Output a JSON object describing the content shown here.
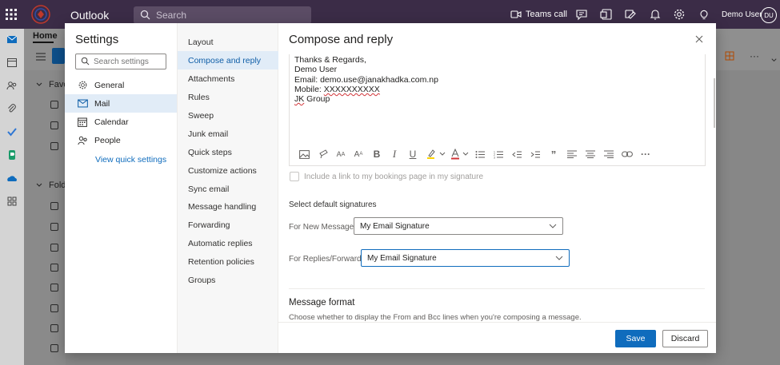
{
  "app": {
    "name": "Outlook"
  },
  "search": {
    "placeholder": "Search"
  },
  "topbar": {
    "teams_call": "Teams call",
    "user_name": "Demo User",
    "avatar_initials": "DU"
  },
  "background": {
    "home_tab": "Home",
    "favorites_label": "Favo",
    "folders_label": "Folde"
  },
  "settings": {
    "title": "Settings",
    "search_placeholder": "Search settings",
    "nav": [
      {
        "label": "General",
        "icon": "gear-icon"
      },
      {
        "label": "Mail",
        "icon": "mail-icon",
        "selected": true
      },
      {
        "label": "Calendar",
        "icon": "calendar-icon"
      },
      {
        "label": "People",
        "icon": "people-icon"
      }
    ],
    "view_quick_settings": "View quick settings",
    "mail_nav": [
      "Layout",
      "Compose and reply",
      "Attachments",
      "Rules",
      "Sweep",
      "Junk email",
      "Quick steps",
      "Customize actions",
      "Sync email",
      "Message handling",
      "Forwarding",
      "Automatic replies",
      "Retention policies",
      "Groups"
    ],
    "mail_nav_selected": "Compose and reply"
  },
  "compose": {
    "title": "Compose and reply",
    "signature_lines": {
      "l1": "Thanks & Regards,",
      "l2": "Demo User",
      "l3": "Email: demo.use@janakhadka.com.np",
      "l4_prefix": "Mobile: ",
      "l4_number": "XXXXXXXXXX",
      "l5_jk": "JK",
      "l5_rest": " Group"
    },
    "bookings_checkbox": "Include a link to my bookings page in my signature",
    "default_signatures_label": "Select default signatures",
    "for_new_label": "For New Messages:",
    "for_new_value": "My Email Signature",
    "for_replies_label": "For Replies/Forwards:",
    "for_replies_value": "My Email Signature",
    "message_format_title": "Message format",
    "message_format_desc": "Choose whether to display the From and Bcc lines when you're composing a message.",
    "save": "Save",
    "discard": "Discard"
  },
  "colors": {
    "accent": "#0f6cbd",
    "topbar": "#3b2c47",
    "selected_nav": "#e1ecf7"
  }
}
